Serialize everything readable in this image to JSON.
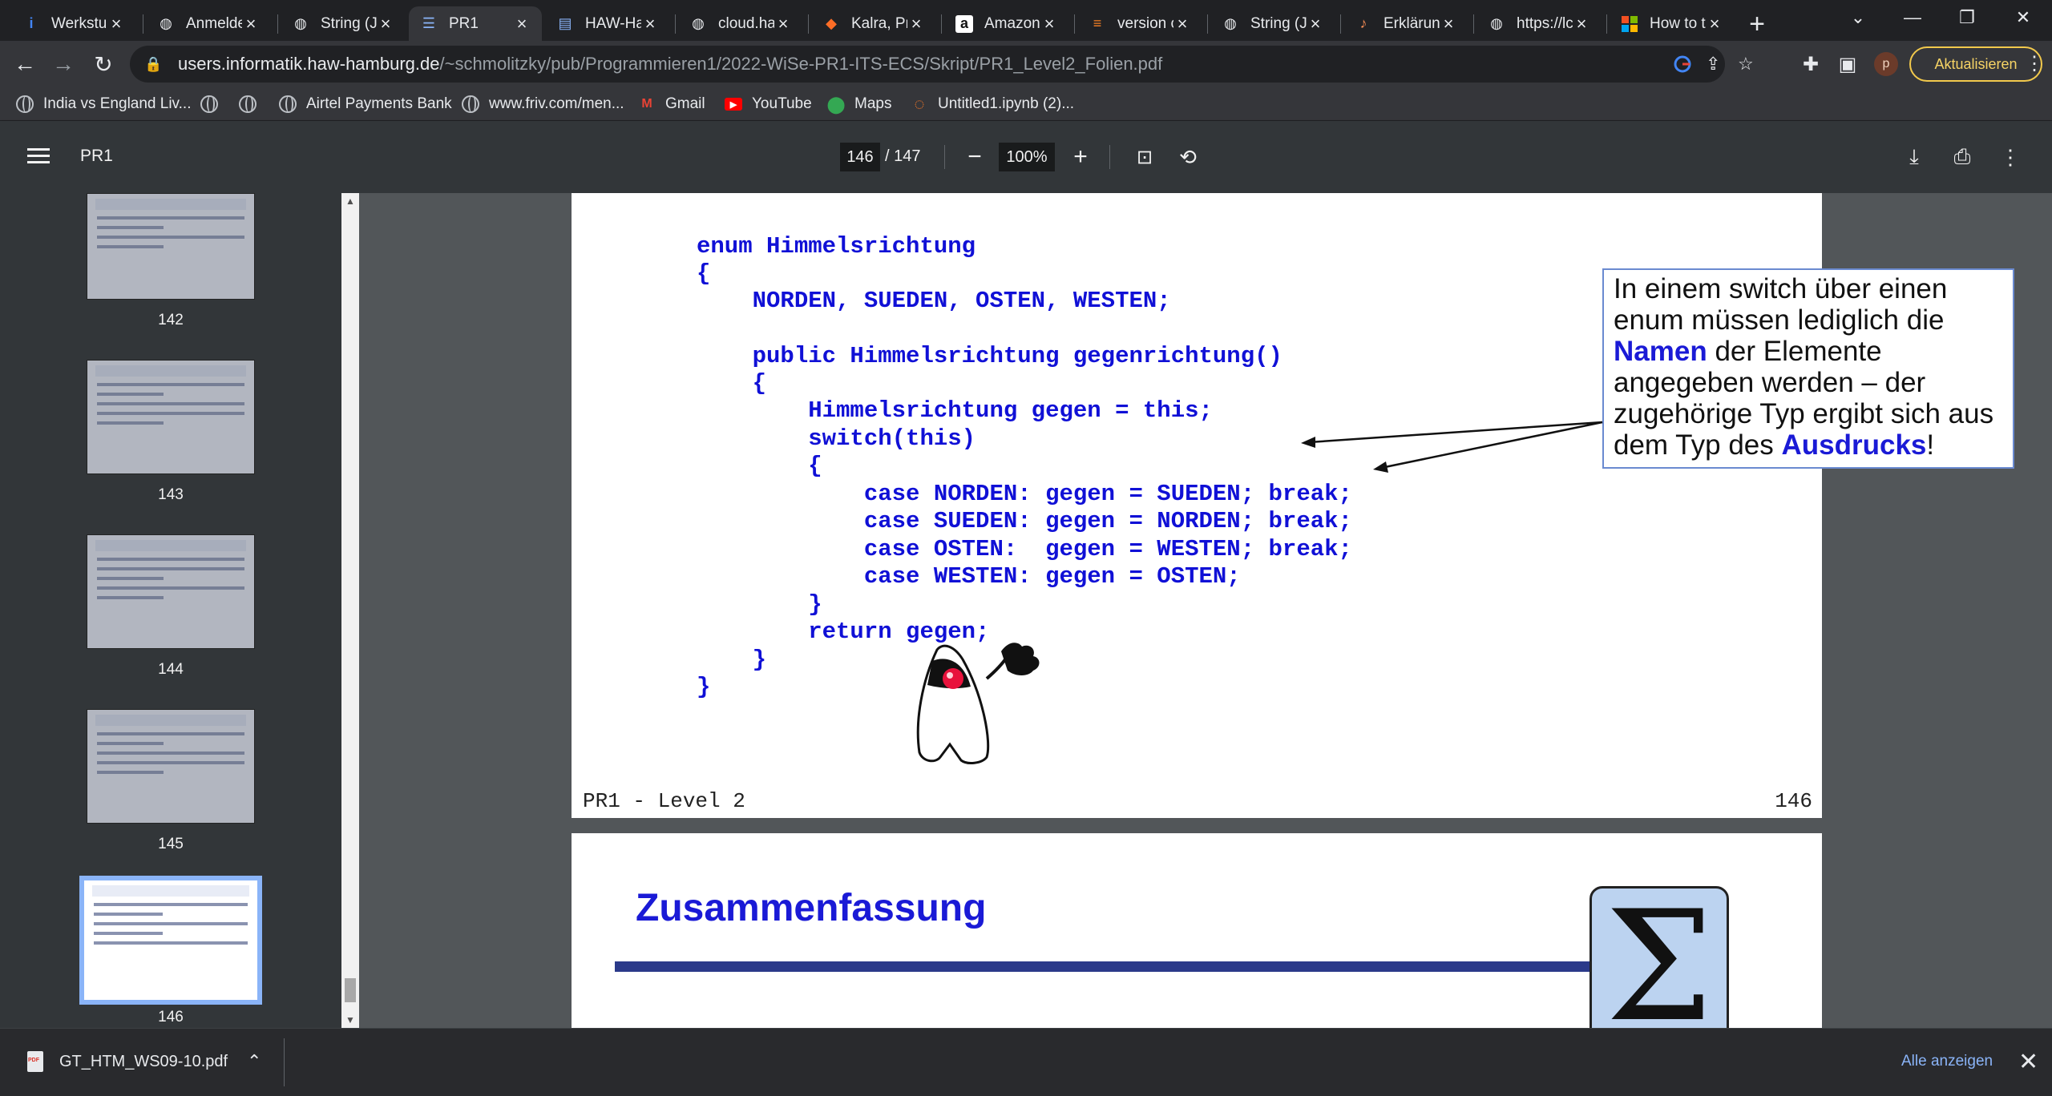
{
  "browser": {
    "tabs": [
      {
        "title": "Werkstu",
        "icon": "info-icon",
        "active": false
      },
      {
        "title": "Anmelde",
        "icon": "globe-icon",
        "active": false
      },
      {
        "title": "String (Ja",
        "icon": "globe-icon",
        "active": false
      },
      {
        "title": "PR1",
        "icon": "pdf-icon",
        "active": true
      },
      {
        "title": "HAW-Ha",
        "icon": "doc-icon",
        "active": false
      },
      {
        "title": "cloud.ha",
        "icon": "globe-icon",
        "active": false
      },
      {
        "title": "Kalra, Pr",
        "icon": "gitlab-icon",
        "active": false
      },
      {
        "title": "Amazon",
        "icon": "amazon-icon",
        "active": false
      },
      {
        "title": "version c",
        "icon": "stackoverflow-icon",
        "active": false
      },
      {
        "title": "String (Ja",
        "icon": "globe-icon",
        "active": false
      },
      {
        "title": "Erklärun",
        "icon": "app-icon",
        "active": false
      },
      {
        "title": "https://lc",
        "icon": "globe-icon",
        "active": false
      },
      {
        "title": "How to t",
        "icon": "microsoft-icon",
        "active": false
      }
    ],
    "new_tab_label": "+",
    "url_host": "users.informatik.haw-hamburg.de",
    "url_path": "/~schmolitzky/pub/Programmieren1/2022-WiSe-PR1-ITS-ECS/Skript/PR1_Level2_Folien.pdf",
    "profile_initial": "p",
    "update_button": "Aktualisieren",
    "bookmarks": [
      {
        "label": "India vs England Liv...",
        "icon": "globe-icon"
      },
      {
        "label": "",
        "icon": "globe-icon"
      },
      {
        "label": "",
        "icon": "globe-icon"
      },
      {
        "label": "Airtel Payments Bank",
        "icon": "globe-icon"
      },
      {
        "label": "www.friv.com/men...",
        "icon": "globe-icon"
      },
      {
        "label": "Gmail",
        "icon": "gmail-icon"
      },
      {
        "label": "YouTube",
        "icon": "youtube-icon"
      },
      {
        "label": "Maps",
        "icon": "maps-icon"
      },
      {
        "label": "Untitled1.ipynb (2)...",
        "icon": "jupyter-icon"
      }
    ]
  },
  "pdf_viewer": {
    "title": "PR1",
    "current_page": "146",
    "total_pages": "/ 147",
    "zoom": "100%",
    "thumbnails": [
      {
        "number": "142"
      },
      {
        "number": "143"
      },
      {
        "number": "144"
      },
      {
        "number": "145"
      },
      {
        "number": "146"
      }
    ]
  },
  "slide": {
    "code_lines": [
      "enum Himmelsrichtung",
      "{",
      "    NORDEN, SUEDEN, OSTEN, WESTEN;",
      "",
      "    public Himmelsrichtung gegenrichtung()",
      "    {",
      "        Himmelsrichtung gegen = this;",
      "        switch(this)",
      "        {",
      "            case NORDEN: gegen = SUEDEN; break;",
      "            case SUEDEN: gegen = NORDEN; break;",
      "            case OSTEN:  gegen = WESTEN; break;",
      "            case WESTEN: gegen = OSTEN;",
      "        }",
      "        return gegen;",
      "    }",
      "}"
    ],
    "callout": {
      "part1": "In einem switch über einen enum müssen lediglich die",
      "bold1": "Namen",
      "part2": "der Elemente angegeben werden – der zugehörige Typ ergibt sich aus dem Typ des",
      "bold2": "Ausdrucks",
      "part3": "!"
    },
    "footer_left": "PR1 - Level 2",
    "footer_right": "146"
  },
  "next_slide": {
    "title": "Zusammenfassung",
    "symbol": "Σ"
  },
  "downloads": {
    "file_name": "GT_HTM_WS09-10.pdf",
    "show_all": "Alle anzeigen"
  },
  "colors": {
    "code_blue": "#1010d6",
    "accent_yellow": "#f2c94c",
    "link_blue": "#8ab4f8"
  }
}
